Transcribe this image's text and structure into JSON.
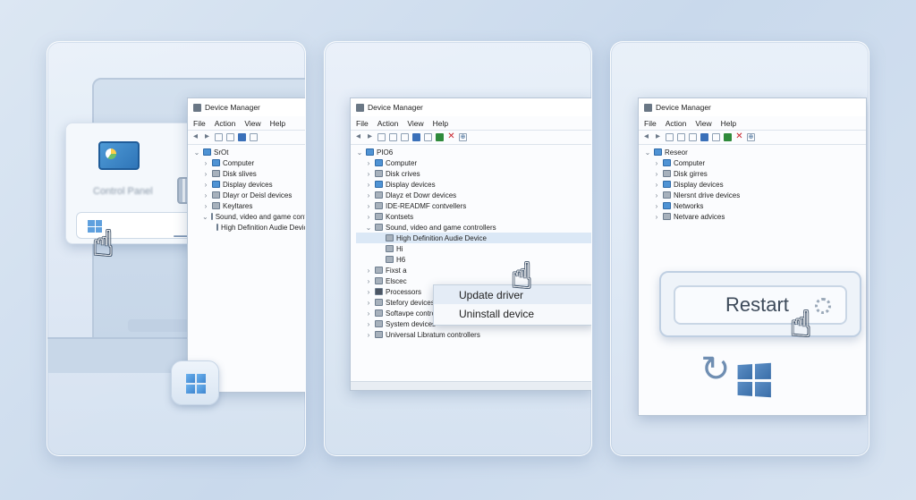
{
  "panels": {
    "p1": {
      "control_panel_label": "Control Panel",
      "window": {
        "title": "Device Manager",
        "menu": [
          "File",
          "Action",
          "View",
          "Help"
        ],
        "tree": [
          {
            "level": 0,
            "label": "SrOt",
            "icon": "computer-icon",
            "chevron": "⌄"
          },
          {
            "level": 1,
            "label": "Computer",
            "icon": "computer-icon",
            "chevron": "›"
          },
          {
            "level": 1,
            "label": "Disk slives",
            "icon": "disk-icon",
            "chevron": "›"
          },
          {
            "level": 1,
            "label": "Display devices",
            "icon": "display-icon",
            "chevron": "›"
          },
          {
            "level": 1,
            "label": "Dlayr or Deisl devices",
            "icon": "device-icon",
            "chevron": "›"
          },
          {
            "level": 1,
            "label": "Keyltares",
            "icon": "keyboard-icon",
            "chevron": "›"
          },
          {
            "level": 1,
            "label": "Sound, video and game controllers",
            "icon": "sound-icon",
            "chevron": "⌄"
          },
          {
            "level": 2,
            "label": "High Definition Audie Device",
            "icon": "speaker-icon",
            "chevron": ""
          }
        ]
      }
    },
    "p2": {
      "window": {
        "title": "Device Manager",
        "menu": [
          "File",
          "Action",
          "View",
          "Help"
        ],
        "tree": [
          {
            "level": 0,
            "label": "PIO6",
            "icon": "computer-icon",
            "chevron": "⌄"
          },
          {
            "level": 1,
            "label": "Computer",
            "icon": "computer-icon",
            "chevron": "›"
          },
          {
            "level": 1,
            "label": "Disk crives",
            "icon": "disk-icon",
            "chevron": "›"
          },
          {
            "level": 1,
            "label": "Display devices",
            "icon": "display-icon",
            "chevron": "›"
          },
          {
            "level": 1,
            "label": "Dlayz et Dowr devices",
            "icon": "device-icon",
            "chevron": "›"
          },
          {
            "level": 1,
            "label": "IDE-READMF contvellers",
            "icon": "ide-icon",
            "chevron": "›"
          },
          {
            "level": 1,
            "label": "Kontsets",
            "icon": "keyboard-icon",
            "chevron": "›"
          },
          {
            "level": 1,
            "label": "Sound, video and game controllers",
            "icon": "sound-icon",
            "chevron": "⌄"
          },
          {
            "level": 2,
            "label": "High Definition Audie Device",
            "icon": "speaker-icon",
            "chevron": "",
            "highlight": true
          },
          {
            "level": 2,
            "label": "Hi",
            "icon": "speaker-icon",
            "chevron": ""
          },
          {
            "level": 2,
            "label": "H6",
            "icon": "speaker-icon",
            "chevron": ""
          },
          {
            "level": 1,
            "label": "Fixst a",
            "icon": "device-icon",
            "chevron": "›"
          },
          {
            "level": 1,
            "label": "Elscec",
            "icon": "device-icon",
            "chevron": "›"
          },
          {
            "level": 1,
            "label": "Processors",
            "icon": "cpu-icon",
            "chevron": "›"
          },
          {
            "level": 1,
            "label": "Stefory devices",
            "icon": "device-icon",
            "chevron": "›"
          },
          {
            "level": 1,
            "label": "Softavpe controllers",
            "icon": "device-icon",
            "chevron": "›"
          },
          {
            "level": 1,
            "label": "System devices",
            "icon": "device-icon",
            "chevron": "›"
          },
          {
            "level": 1,
            "label": "Universal Libratum controllers",
            "icon": "usb-icon",
            "chevron": "›"
          }
        ]
      },
      "context_menu": [
        "Update driver",
        "Uninstall device"
      ]
    },
    "p3": {
      "window": {
        "title": "Device Manager",
        "menu": [
          "File",
          "Action",
          "View",
          "Help"
        ],
        "tree": [
          {
            "level": 0,
            "label": "Reseor",
            "icon": "computer-icon",
            "chevron": "⌄"
          },
          {
            "level": 1,
            "label": "Computer",
            "icon": "computer-icon",
            "chevron": "›"
          },
          {
            "level": 1,
            "label": "Disk girres",
            "icon": "disk-icon",
            "chevron": "›"
          },
          {
            "level": 1,
            "label": "Display devices",
            "icon": "display-icon",
            "chevron": "›"
          },
          {
            "level": 1,
            "label": "Nlersnt drive devices",
            "icon": "device-icon",
            "chevron": "›"
          },
          {
            "level": 1,
            "label": "Networks",
            "icon": "network-icon",
            "chevron": "›"
          },
          {
            "level": 1,
            "label": "Netvare advices",
            "icon": "device-icon",
            "chevron": "›"
          }
        ]
      },
      "restart_label": "Restart"
    }
  },
  "colors": {
    "background": "#d3e0ee",
    "accent": "#3a70b9",
    "panel_border": "#bfcfe2"
  }
}
